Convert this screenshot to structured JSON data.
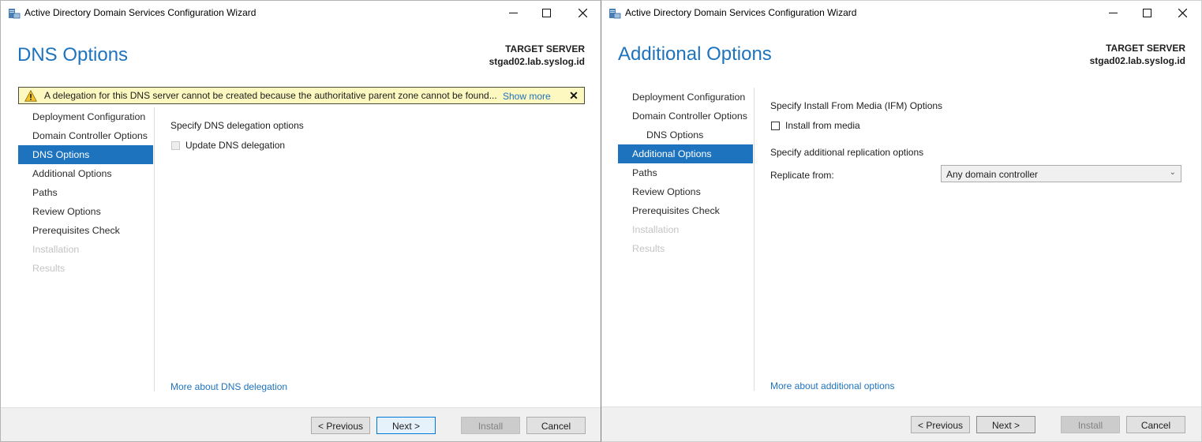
{
  "colors": {
    "accent": "#1e73be",
    "warning_bg": "#fcf8bf",
    "nav_active_bg": "#1e73be"
  },
  "left_window": {
    "title": "Active Directory Domain Services Configuration Wizard",
    "page_title": "DNS Options",
    "target_server_label": "TARGET SERVER",
    "target_server_name": "stgad02.lab.syslog.id",
    "warning": {
      "icon": "warning-triangle-icon",
      "text": "A delegation for this DNS server cannot be created because the authoritative parent zone cannot be found...",
      "link": "Show more",
      "close": "✕"
    },
    "nav_items": [
      {
        "label": "Deployment Configuration",
        "state": "normal"
      },
      {
        "label": "Domain Controller Options",
        "state": "normal"
      },
      {
        "label": "DNS Options",
        "state": "active"
      },
      {
        "label": "Additional Options",
        "state": "normal"
      },
      {
        "label": "Paths",
        "state": "normal"
      },
      {
        "label": "Review Options",
        "state": "normal"
      },
      {
        "label": "Prerequisites Check",
        "state": "normal"
      },
      {
        "label": "Installation",
        "state": "disabled"
      },
      {
        "label": "Results",
        "state": "disabled"
      }
    ],
    "section_label": "Specify DNS delegation options",
    "checkbox": {
      "label": "Update DNS delegation",
      "checked": false,
      "enabled": false
    },
    "help_link": "More about DNS delegation",
    "buttons": {
      "previous": "< Previous",
      "next": "Next >",
      "install": "Install",
      "cancel": "Cancel"
    }
  },
  "right_window": {
    "title": "Active Directory Domain Services Configuration Wizard",
    "page_title": "Additional Options",
    "target_server_label": "TARGET SERVER",
    "target_server_name": "stgad02.lab.syslog.id",
    "nav_items": [
      {
        "label": "Deployment Configuration",
        "state": "normal"
      },
      {
        "label": "Domain Controller Options",
        "state": "normal"
      },
      {
        "label": "DNS Options",
        "state": "sub"
      },
      {
        "label": "Additional Options",
        "state": "active"
      },
      {
        "label": "Paths",
        "state": "normal"
      },
      {
        "label": "Review Options",
        "state": "normal"
      },
      {
        "label": "Prerequisites Check",
        "state": "normal"
      },
      {
        "label": "Installation",
        "state": "disabled"
      },
      {
        "label": "Results",
        "state": "disabled"
      }
    ],
    "ifm_section_label": "Specify Install From Media (IFM) Options",
    "ifm_checkbox": {
      "label": "Install from media",
      "checked": false
    },
    "replication_section_label": "Specify additional replication options",
    "replicate_from_label": "Replicate from:",
    "replicate_from_value": "Any domain controller",
    "help_link": "More about additional options",
    "buttons": {
      "previous": "< Previous",
      "next": "Next >",
      "install": "Install",
      "cancel": "Cancel"
    }
  }
}
